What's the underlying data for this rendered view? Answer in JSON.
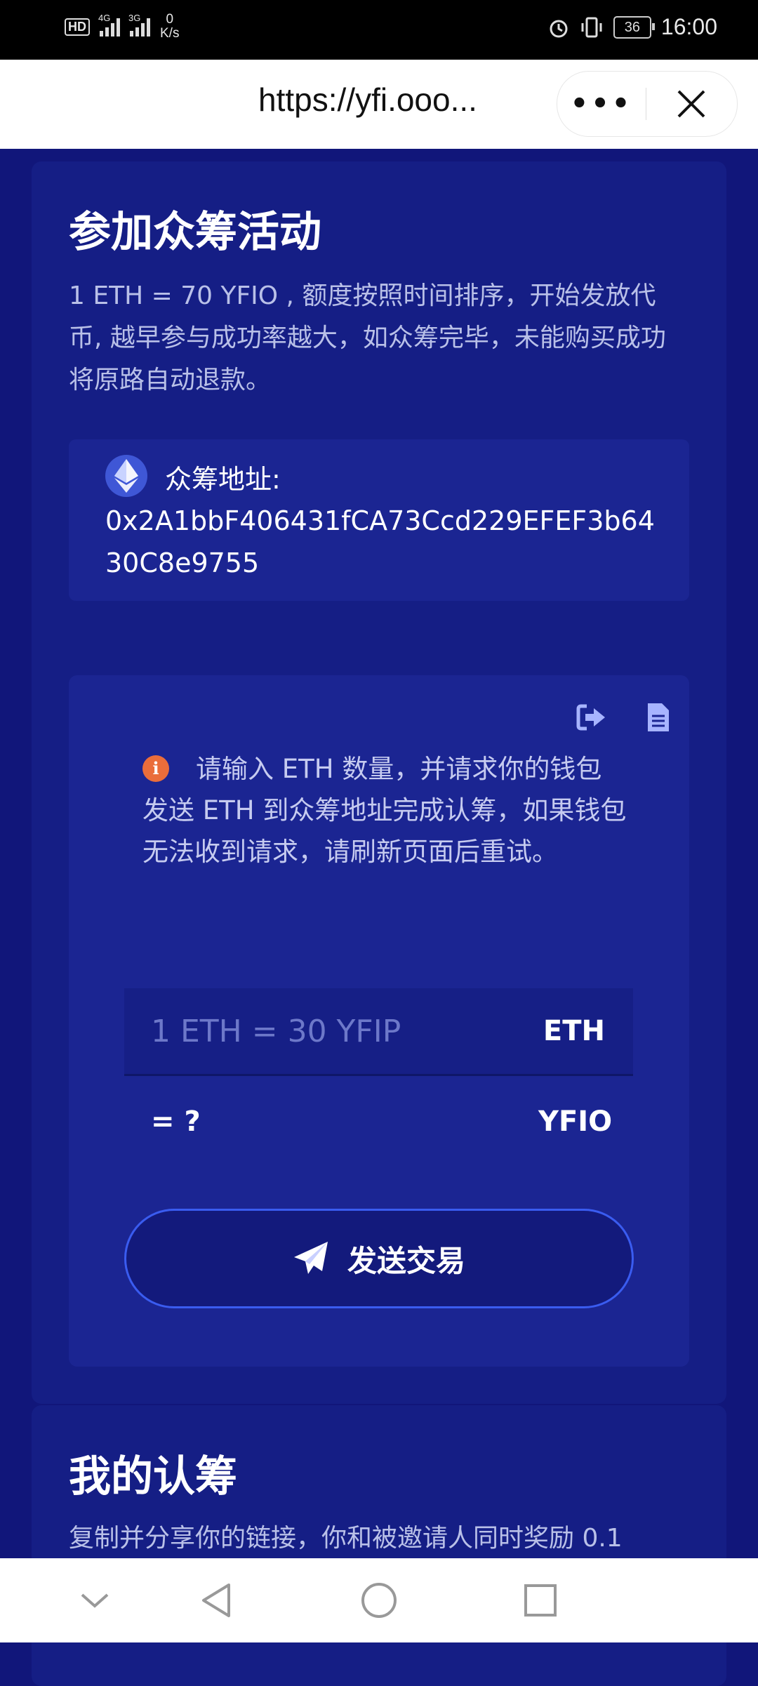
{
  "status_bar": {
    "hd": "HD",
    "sig1": "4G",
    "sig2": "3G",
    "speed_value": "0",
    "speed_unit": "K/s",
    "battery": "36",
    "time": "16:00"
  },
  "browser": {
    "url": "https://yfi.ooo...",
    "more_label": "•••"
  },
  "crowdfund": {
    "title": "参加众筹活动",
    "description": "1 ETH = 70 YFIO , 额度按照时间排序，开始发放代币, 越早参与成功率越大，如众筹完毕，未能购买成功将原路自动退款。",
    "address_label": "众筹地址:",
    "address": "0x2A1bbF406431fCA73Ccd229EFEF3b6430C8e9755"
  },
  "form": {
    "info_text": "请输入 ETH 数量，并请求你的钱包发送 ETH 到众筹地址完成认筹，如果钱包无法收到请求，请刷新页面后重试。",
    "info_icon_glyph": "i",
    "input_placeholder": "1 ETH = 30 YFIP",
    "input_unit": "ETH",
    "result": "= ?",
    "result_unit": "YFIO",
    "send_label": "发送交易"
  },
  "my_subscription": {
    "title": "我的认筹",
    "description": "复制并分享你的链接，你和被邀请人同时奖励 0.1"
  },
  "colors": {
    "background": "#11167a",
    "card": "#151e85",
    "accent": "#3a5cf0",
    "info": "#ea6d3b"
  }
}
